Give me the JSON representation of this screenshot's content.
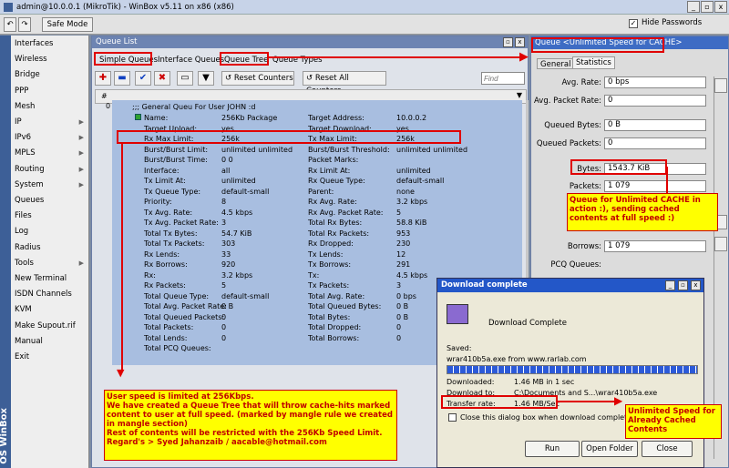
{
  "window": {
    "title": "admin@10.0.0.1 (MikroTik) - WinBox v5.11 on x86 (x86)",
    "min": "_",
    "max": "▫",
    "close": "x"
  },
  "toolbar": {
    "safe_mode": "Safe Mode",
    "hide_passwords": "Hide Passwords"
  },
  "sidebar": {
    "brand": "OS WinBox",
    "items": [
      {
        "label": "Interfaces",
        "sub": false
      },
      {
        "label": "Wireless",
        "sub": false
      },
      {
        "label": "Bridge",
        "sub": false
      },
      {
        "label": "PPP",
        "sub": false
      },
      {
        "label": "Mesh",
        "sub": false
      },
      {
        "label": "IP",
        "sub": true
      },
      {
        "label": "IPv6",
        "sub": true
      },
      {
        "label": "MPLS",
        "sub": true
      },
      {
        "label": "Routing",
        "sub": true
      },
      {
        "label": "System",
        "sub": true
      },
      {
        "label": "Queues",
        "sub": false
      },
      {
        "label": "Files",
        "sub": false
      },
      {
        "label": "Log",
        "sub": false
      },
      {
        "label": "Radius",
        "sub": false
      },
      {
        "label": "Tools",
        "sub": true
      },
      {
        "label": "New Terminal",
        "sub": false
      },
      {
        "label": "ISDN Channels",
        "sub": false
      },
      {
        "label": "KVM",
        "sub": false
      },
      {
        "label": "Make Supout.rif",
        "sub": false
      },
      {
        "label": "Manual",
        "sub": false
      },
      {
        "label": "Exit",
        "sub": false
      }
    ]
  },
  "queue_list": {
    "title": "Queue List",
    "tabs": [
      "Simple Queues",
      "Interface Queues",
      "Queue Tree",
      "Queue Types"
    ],
    "reset_counters": "Reset Counters",
    "reset_all_counters": "Reset All Counters",
    "find_placeholder": "Find",
    "col_hash": "#",
    "row_index": "0",
    "comment": ";;; General Queu For User JOHN :d",
    "left_rows": [
      [
        "Name:",
        "256Kb Package"
      ],
      [
        "Target Upload:",
        "yes"
      ],
      [
        "Rx Max Limit:",
        "256k"
      ],
      [
        "Burst/Burst Limit:",
        "unlimited unlimited"
      ],
      [
        "Burst/Burst Time:",
        "0 0"
      ],
      [
        "Interface:",
        "all"
      ],
      [
        "Tx Limit At:",
        "unlimited"
      ],
      [
        "Tx Queue Type:",
        "default-small"
      ],
      [
        "Priority:",
        "8"
      ],
      [
        "Tx Avg. Rate:",
        "4.5 kbps"
      ],
      [
        "Tx Avg. Packet Rate:",
        "3"
      ],
      [
        "Total Tx Bytes:",
        "54.7 KiB"
      ],
      [
        "Total Tx Packets:",
        "303"
      ],
      [
        "Rx Lends:",
        "33"
      ],
      [
        "Rx Borrows:",
        "920"
      ],
      [
        "Rx:",
        "3.2 kbps"
      ],
      [
        "Rx Packets:",
        "5"
      ],
      [
        "Total Queue Type:",
        "default-small"
      ],
      [
        "Total Avg. Packet Rate:",
        "0 B"
      ],
      [
        "Total Queued Packets:",
        "0"
      ],
      [
        "Total Packets:",
        "0"
      ],
      [
        "Total Lends:",
        "0"
      ],
      [
        "Total PCQ Queues:",
        ""
      ]
    ],
    "right_rows": [
      [
        "Target Address:",
        "10.0.0.2"
      ],
      [
        "Target Download:",
        "yes"
      ],
      [
        "Tx Max Limit:",
        "256k"
      ],
      [
        "Burst/Burst Threshold:",
        "unlimited unlimited"
      ],
      [
        "Packet Marks:",
        ""
      ],
      [
        "Rx Limit At:",
        "unlimited"
      ],
      [
        "Rx Queue Type:",
        "default-small"
      ],
      [
        "Parent:",
        "none"
      ],
      [
        "Rx Avg. Rate:",
        "3.2 kbps"
      ],
      [
        "Rx Avg. Packet Rate:",
        "5"
      ],
      [
        "Total Rx Bytes:",
        "58.8 KiB"
      ],
      [
        "Total Rx Packets:",
        "953"
      ],
      [
        "Rx Dropped:",
        "230"
      ],
      [
        "Tx Lends:",
        "12"
      ],
      [
        "Tx Borrows:",
        "291"
      ],
      [
        "Tx:",
        "4.5 kbps"
      ],
      [
        "Tx Packets:",
        "3"
      ],
      [
        "Total Avg. Rate:",
        "0 bps"
      ],
      [
        "Total Queued Bytes:",
        "0 B"
      ],
      [
        "Total Bytes:",
        "0 B"
      ],
      [
        "Total Dropped:",
        "0"
      ],
      [
        "Total Borrows:",
        "0"
      ]
    ]
  },
  "queue_panel": {
    "title": "Queue <Unlimited Speed for CACHE>",
    "tabs": [
      "General",
      "Statistics"
    ],
    "fields": [
      {
        "label": "Avg. Rate:",
        "value": "0 bps"
      },
      {
        "label": "Avg. Packet Rate:",
        "value": "0"
      },
      {
        "label": "Queued Bytes:",
        "value": "0 B"
      },
      {
        "label": "Queued Packets:",
        "value": "0"
      },
      {
        "label": "Bytes:",
        "value": "1543.7 KiB"
      },
      {
        "label": "Packets:",
        "value": "1 079"
      },
      {
        "label": "Borrows:",
        "value": "1 079"
      },
      {
        "label": "PCQ Queues:",
        "value": ""
      }
    ]
  },
  "download": {
    "title": "Download complete",
    "heading": "Download Complete",
    "saved_label": "Saved:",
    "saved_value": "wrar410b5a.exe from www.rarlab.com",
    "downloaded_label": "Downloaded:",
    "downloaded_value": "1.46 MB in 1 sec",
    "download_to_label": "Download to:",
    "download_to_value": "C:\\Documents and S...\\wrar410b5a.exe",
    "rate_label": "Transfer rate:",
    "rate_value": "1.46 MB/Sec",
    "checkbox": "Close this dialog box when download completes",
    "run": "Run",
    "open_folder": "Open Folder",
    "close": "Close",
    "progress_percent": 100
  },
  "notes": {
    "cache": "Queue for Unlimited CACHE in action :), sending cached contents at full speed :)",
    "user": "User speed is limited at 256Kbps.\nWe have created a Queue Tree that will throw cache-hits marked content to user at full speed. (marked by mangle rule we created in mangle section)\nRest of contents will be restricted with the 256Kb Speed Limit.\nRegard's > Syed Jahanzaib / aacable@hotmail.com",
    "download": "Unlimited Speed for Already Cached Contents"
  }
}
